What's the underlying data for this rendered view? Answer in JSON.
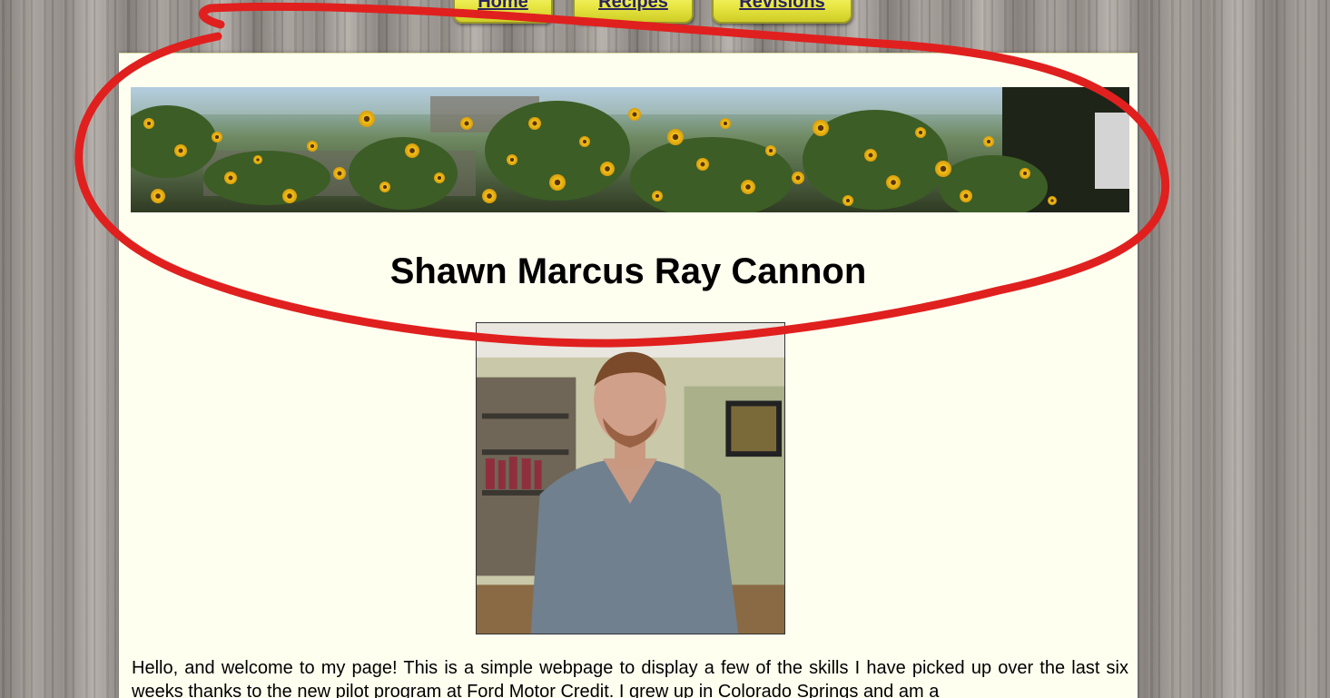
{
  "nav": {
    "items": [
      {
        "label": "Home"
      },
      {
        "label": "Recipes"
      },
      {
        "label": "Revisions"
      }
    ],
    "tab_color": "#e9e845"
  },
  "header": {
    "banner": {
      "description_icon": "sunflower-banner-image"
    },
    "title": "Shawn Marcus Ray Cannon"
  },
  "main": {
    "portrait": {
      "icon": "portrait-photo"
    },
    "intro_text": "Hello, and welcome to my page! This is a simple webpage to display a few of the skills I have picked up over the last six weeks thanks to the new pilot program at Ford Motor Credit. I grew up in Colorado Springs and am a"
  },
  "colors": {
    "panel_background": "#fffff0",
    "annotation": "#e0201e"
  }
}
